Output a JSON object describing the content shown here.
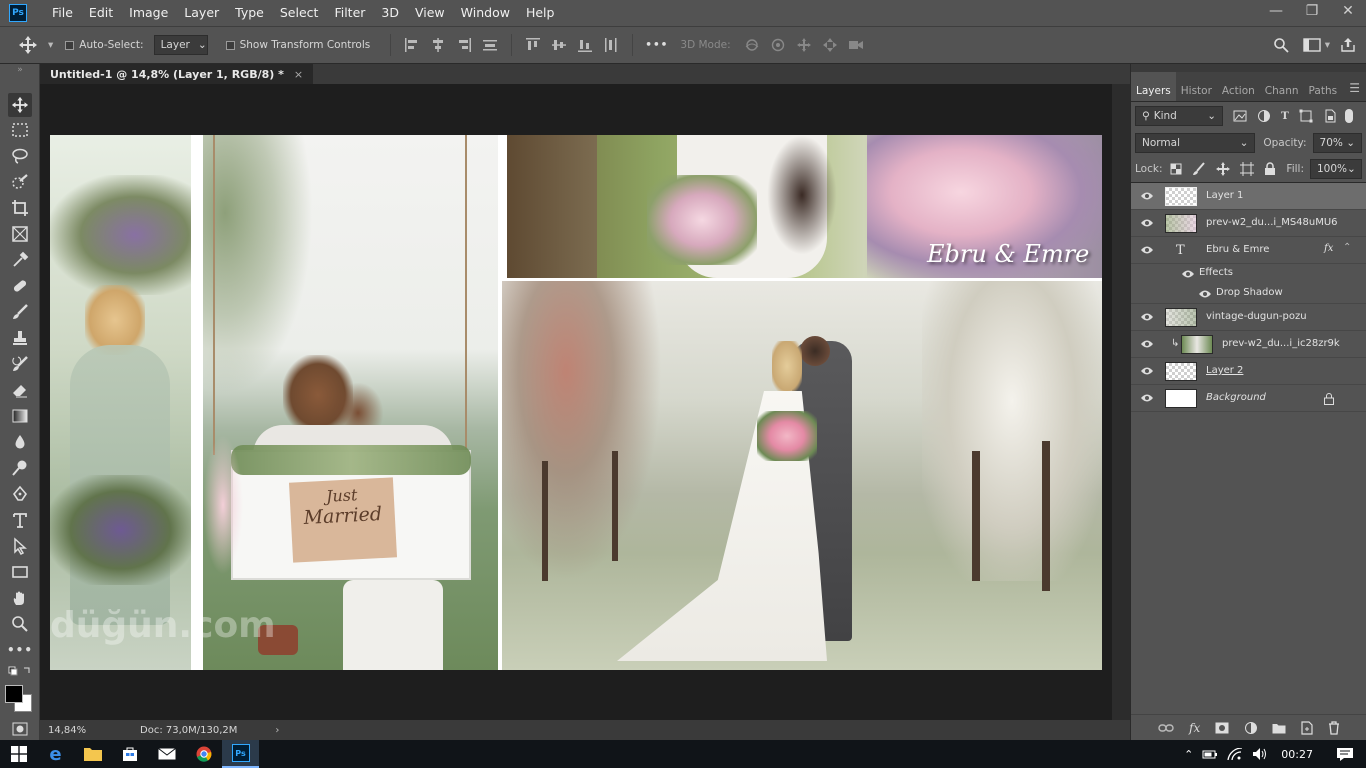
{
  "app": {
    "logo_text": "Ps"
  },
  "menu": [
    "File",
    "Edit",
    "Image",
    "Layer",
    "Type",
    "Select",
    "Filter",
    "3D",
    "View",
    "Window",
    "Help"
  ],
  "options_bar": {
    "auto_select_label": "Auto-Select:",
    "auto_select_value": "Layer",
    "show_transform_label": "Show Transform Controls",
    "more_label": "•••",
    "mode_3d_label": "3D Mode:"
  },
  "document_tab": {
    "title": "Untitled-1 @ 14,8% (Layer 1, RGB/8) *",
    "close": "×"
  },
  "canvas": {
    "overlay_text": "Ebru & Emre",
    "sign_text_line1": "Just",
    "sign_text_line2": "Married",
    "watermark": "düğün.com"
  },
  "status_bar": {
    "zoom": "14,84%",
    "doc": "Doc: 73,0M/130,2M"
  },
  "panel": {
    "tabs": [
      "Layers",
      "Histor",
      "Action",
      "Chann",
      "Paths"
    ],
    "active_tab": "Layers",
    "filter_kind": "Kind",
    "blend_mode": "Normal",
    "opacity_label": "Opacity:",
    "opacity_value": "70%",
    "lock_label": "Lock:",
    "fill_label": "Fill:",
    "fill_value": "100%",
    "layers": [
      {
        "name": "Layer 1"
      },
      {
        "name": "prev-w2_du...i_MS48uMU6"
      },
      {
        "name": "Ebru & Emre",
        "type_glyph": "T",
        "fx": "fx"
      },
      {
        "name": "Effects"
      },
      {
        "name": "Drop Shadow"
      },
      {
        "name": "vintage-dugun-pozu"
      },
      {
        "name": "prev-w2_du...i_ic28zr9k"
      },
      {
        "name": "Layer 2"
      },
      {
        "name": "Background"
      }
    ]
  },
  "taskbar": {
    "time": "00:27"
  },
  "colors": {
    "accent": "#31a8ff",
    "panel": "#535353",
    "canvas_bg": "#1e1e1e"
  }
}
